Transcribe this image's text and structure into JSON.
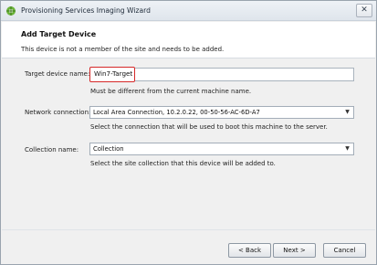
{
  "window": {
    "title": "Provisioning Services Imaging Wizard"
  },
  "header": {
    "title": "Add Target Device",
    "subtitle": "This device is not a member of the site and needs to be added."
  },
  "form": {
    "device_name": {
      "label": "Target device name:",
      "value": "Win7-Target",
      "help": "Must be different from the current machine name."
    },
    "network": {
      "label": "Network connection:",
      "value": "Local Area Connection, 10.2.0.22, 00-50-56-AC-6D-A7",
      "help": "Select the connection that will be used to boot this machine to the server."
    },
    "collection": {
      "label": "Collection name:",
      "value": "Collection",
      "help": "Select the site collection that this device will be added to."
    }
  },
  "buttons": {
    "back": "< Back",
    "next": "Next >",
    "cancel": "Cancel"
  },
  "colors": {
    "highlight": "#d62828",
    "background": "#f0f0f0"
  }
}
